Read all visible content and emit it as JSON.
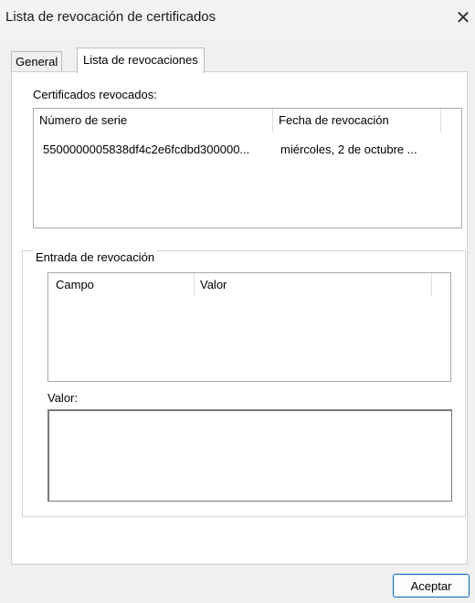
{
  "window": {
    "title": "Lista de revocación de certificados",
    "close_glyph": "✕"
  },
  "tabs": [
    {
      "label": "General",
      "active": false
    },
    {
      "label": "Lista de revocaciones",
      "active": true
    }
  ],
  "revoked": {
    "label": "Certificados revocados:",
    "columns": [
      "Número de serie",
      "Fecha de revocación"
    ],
    "rows": [
      [
        "5500000005838df4c2e6fcdbd300000...",
        "miércoles, 2 de octubre ..."
      ]
    ]
  },
  "entry": {
    "legend": "Entrada de revocación",
    "columns": [
      "Campo",
      "Valor"
    ],
    "value_label": "Valor:",
    "value_text": ""
  },
  "footer": {
    "ok_label": "Aceptar"
  },
  "colors": {
    "accent": "#0067c0",
    "background": "#f0f0f0",
    "panel": "#ffffff"
  }
}
